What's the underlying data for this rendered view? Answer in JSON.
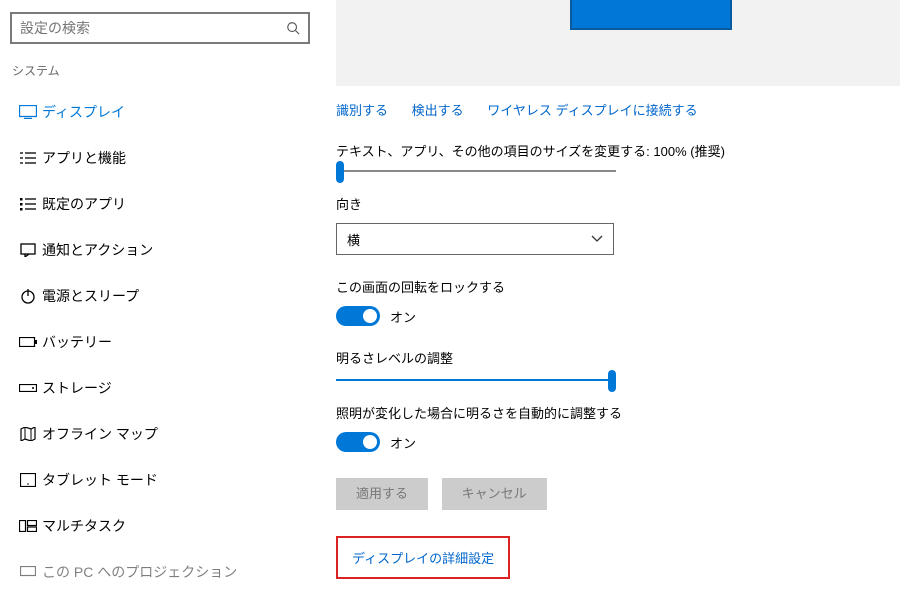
{
  "search": {
    "placeholder": "設定の検索"
  },
  "sidebar": {
    "section": "システム",
    "items": [
      {
        "label": "ディスプレイ",
        "active": true
      },
      {
        "label": "アプリと機能"
      },
      {
        "label": "既定のアプリ"
      },
      {
        "label": "通知とアクション"
      },
      {
        "label": "電源とスリープ"
      },
      {
        "label": "バッテリー"
      },
      {
        "label": "ストレージ"
      },
      {
        "label": "オフライン マップ"
      },
      {
        "label": "タブレット モード"
      },
      {
        "label": "マルチタスク"
      },
      {
        "label": "この PC へのプロジェクション"
      }
    ]
  },
  "links": {
    "identify": "識別する",
    "detect": "検出する",
    "wireless": "ワイヤレス ディスプレイに接続する"
  },
  "scale_label": "テキスト、アプリ、その他の項目のサイズを変更する: 100% (推奨)",
  "orientation": {
    "label": "向き",
    "value": "横"
  },
  "rotation_lock": {
    "label": "この画面の回転をロックする",
    "state": "オン"
  },
  "brightness": {
    "label": "明るさレベルの調整"
  },
  "auto_brightness": {
    "label": "照明が変化した場合に明るさを自動的に調整する",
    "state": "オン"
  },
  "buttons": {
    "apply": "適用する",
    "cancel": "キャンセル"
  },
  "advanced_link": "ディスプレイの詳細設定"
}
